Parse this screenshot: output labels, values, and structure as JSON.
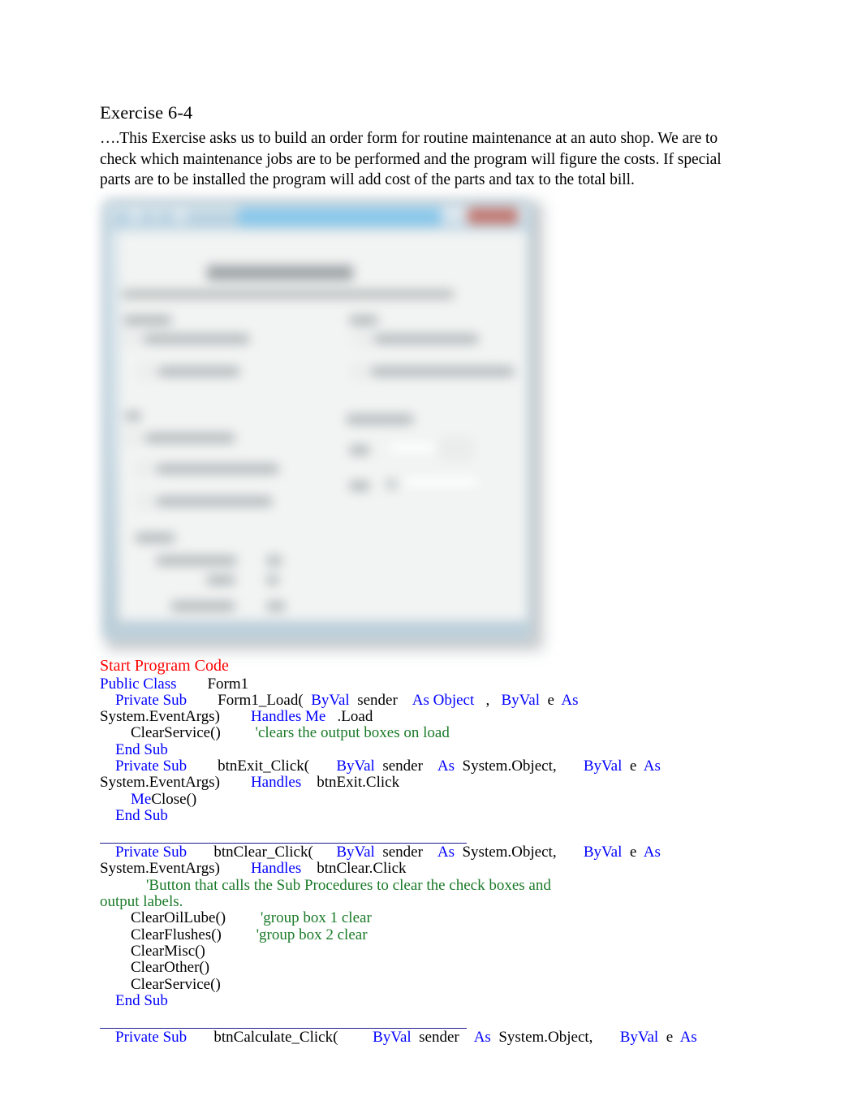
{
  "document": {
    "title": "Exercise 6-4",
    "intro": "….This Exercise asks us to build an order form for routine maintenance at an auto shop. We are to check which maintenance jobs are to be performed and the program will figure the costs. If special parts are to be installed the program will add cost of the parts and tax to the total bill.",
    "screenshot_caption": "",
    "code_heading": "Start Program Code"
  },
  "colors": {
    "heading_red": "#ff0000",
    "keyword_blue": "#0000ff",
    "comment_green": "#1a7a28",
    "body_black": "#000000",
    "rule_navy": "#1f1f8f"
  },
  "code": {
    "lines": [
      [
        {
          "t": "Public Class",
          "c": "kw"
        },
        {
          "t": "        Form1",
          "c": "pl"
        }
      ],
      [
        {
          "t": "    ",
          "c": "pl"
        },
        {
          "t": "Private Sub",
          "c": "kw"
        },
        {
          "t": "        Form1_Load(  ",
          "c": "pl"
        },
        {
          "t": "ByVal",
          "c": "kw"
        },
        {
          "t": "  sender    ",
          "c": "pl"
        },
        {
          "t": "As Object",
          "c": "kw"
        },
        {
          "t": "   ,   ",
          "c": "pl"
        },
        {
          "t": "ByVal",
          "c": "kw"
        },
        {
          "t": "  e  ",
          "c": "pl"
        },
        {
          "t": "As",
          "c": "kw"
        }
      ],
      [
        {
          "t": "System.EventArgs)        ",
          "c": "pl"
        },
        {
          "t": "Handles Me",
          "c": "kw"
        },
        {
          "t": "   .Load",
          "c": "pl"
        }
      ],
      [
        {
          "t": "        ClearService()         ",
          "c": "pl"
        },
        {
          "t": "'clears the output boxes on load",
          "c": "cm"
        }
      ],
      [
        {
          "t": "    ",
          "c": "pl"
        },
        {
          "t": "End Sub",
          "c": "kw"
        }
      ],
      [
        {
          "t": "    ",
          "c": "pl"
        },
        {
          "t": "Private Sub",
          "c": "kw"
        },
        {
          "t": "        btnExit_Click(       ",
          "c": "pl"
        },
        {
          "t": "ByVal",
          "c": "kw"
        },
        {
          "t": "  sender    ",
          "c": "pl"
        },
        {
          "t": "As",
          "c": "kw"
        },
        {
          "t": "  System.Object,       ",
          "c": "pl"
        },
        {
          "t": "ByVal",
          "c": "kw"
        },
        {
          "t": "  e  ",
          "c": "pl"
        },
        {
          "t": "As",
          "c": "kw"
        }
      ],
      [
        {
          "t": "System.EventArgs)        ",
          "c": "pl"
        },
        {
          "t": "Handles",
          "c": "kw"
        },
        {
          "t": "    btnExit.Click",
          "c": "pl"
        }
      ],
      [
        {
          "t": "        ",
          "c": "pl"
        },
        {
          "t": "Me",
          "c": "kw"
        },
        {
          "t": "Close()",
          "c": "pl"
        }
      ],
      [
        {
          "t": "    ",
          "c": "pl"
        },
        {
          "t": "End Sub",
          "c": "kw"
        }
      ],
      [],
      [
        {
          "t": "__RULE__",
          "c": "rule"
        }
      ],
      [
        {
          "t": "    ",
          "c": "pl"
        },
        {
          "t": "Private Sub",
          "c": "kw"
        },
        {
          "t": "       btnClear_Click(      ",
          "c": "pl"
        },
        {
          "t": "ByVal",
          "c": "kw"
        },
        {
          "t": "  sender    ",
          "c": "pl"
        },
        {
          "t": "As",
          "c": "kw"
        },
        {
          "t": "  System.Object,       ",
          "c": "pl"
        },
        {
          "t": "ByVal",
          "c": "kw"
        },
        {
          "t": "  e  ",
          "c": "pl"
        },
        {
          "t": "As",
          "c": "kw"
        }
      ],
      [
        {
          "t": "System.EventArgs)        ",
          "c": "pl"
        },
        {
          "t": "Handles",
          "c": "kw"
        },
        {
          "t": "    btnClear.Click",
          "c": "pl"
        }
      ],
      [
        {
          "t": "            ",
          "c": "pl"
        },
        {
          "t": "'Button that calls the Sub Procedures to clear the check boxes and",
          "c": "cm"
        }
      ],
      [
        {
          "t": "output labels.",
          "c": "cm"
        }
      ],
      [
        {
          "t": "        ClearOilLube()         ",
          "c": "pl"
        },
        {
          "t": "'group box 1 clear",
          "c": "cm"
        }
      ],
      [
        {
          "t": "        ClearFlushes()         ",
          "c": "pl"
        },
        {
          "t": "'group box 2 clear",
          "c": "cm"
        }
      ],
      [
        {
          "t": "        ClearMisc()",
          "c": "pl"
        }
      ],
      [
        {
          "t": "        ClearOther()",
          "c": "pl"
        }
      ],
      [
        {
          "t": "        ClearService()",
          "c": "pl"
        }
      ],
      [
        {
          "t": "    ",
          "c": "pl"
        },
        {
          "t": "End Sub",
          "c": "kw"
        }
      ],
      [],
      [
        {
          "t": "__RULE__",
          "c": "rule"
        }
      ],
      [
        {
          "t": "    ",
          "c": "pl"
        },
        {
          "t": "Private Sub",
          "c": "kw"
        },
        {
          "t": "       btnCalculate_Click(         ",
          "c": "pl"
        },
        {
          "t": "ByVal",
          "c": "kw"
        },
        {
          "t": "  sender    ",
          "c": "pl"
        },
        {
          "t": "As",
          "c": "kw"
        },
        {
          "t": "  System.Object,       ",
          "c": "pl"
        },
        {
          "t": "ByVal",
          "c": "kw"
        },
        {
          "t": "  e  ",
          "c": "pl"
        },
        {
          "t": "As",
          "c": "kw"
        }
      ]
    ]
  },
  "screenshot": {
    "description": "Blurred screenshot of a Visual Basic Windows Forms auto shop maintenance order form",
    "window_title": "",
    "close_button_color": "#c2776f",
    "accent_button_color": "#8fc2de",
    "chrome_color": "#bcd2de"
  }
}
